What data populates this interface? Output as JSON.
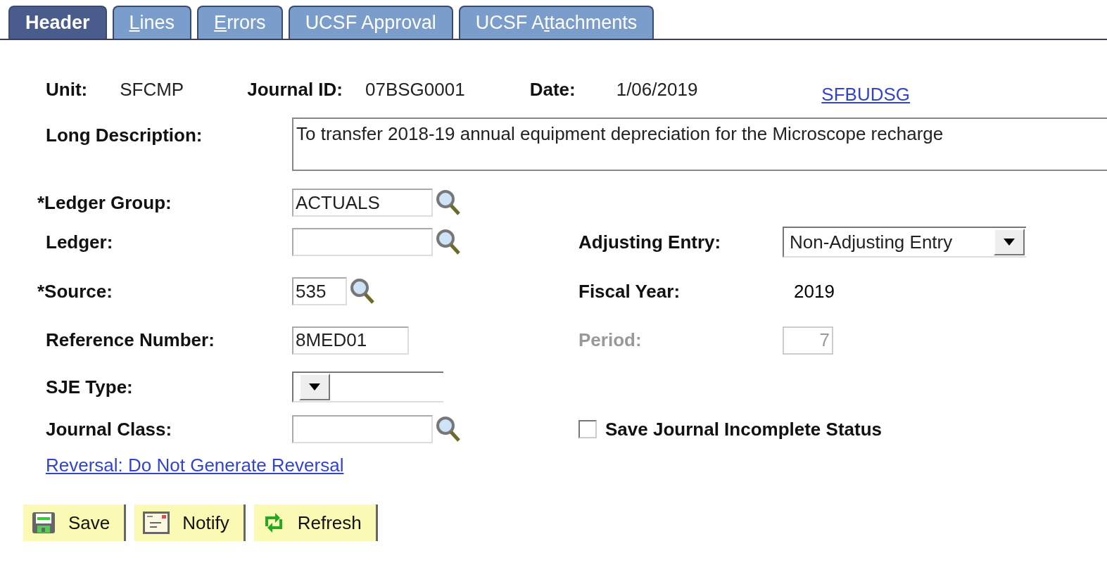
{
  "tabs": [
    {
      "label_post": "Header",
      "selected": true
    },
    {
      "access_key": "L",
      "label_post": "ines",
      "selected": false
    },
    {
      "access_key": "E",
      "label_post": "rrors",
      "selected": false
    },
    {
      "label_post": "UCSF Approval",
      "selected": false
    },
    {
      "label_pre": "UCSF A",
      "access_key": "t",
      "label_post": "tachments",
      "selected": false
    }
  ],
  "summary": [
    {
      "label": "Unit:",
      "value": "SFCMP"
    },
    {
      "label": "Journal ID:",
      "value": "07BSG0001"
    },
    {
      "label": "Date:",
      "value": "1/06/2019"
    }
  ],
  "user_link": "SFBUDSG",
  "long_description": {
    "label": "Long Description:",
    "value": "To transfer 2018-19 annual equipment depreciation for the Microscope recharge"
  },
  "rows": [
    {
      "left": {
        "label": "*Ledger Group:",
        "kind": "lookup",
        "value": "ACTUALS"
      }
    },
    {
      "left": {
        "label": "Ledger:",
        "kind": "lookup"
      },
      "right": {
        "label": "Adjusting Entry:",
        "kind": "select",
        "value": "Non-Adjusting Entry"
      }
    },
    {
      "left": {
        "label": "*Source:",
        "kind": "lookup",
        "value": "535"
      },
      "right": {
        "label": "Fiscal Year:",
        "kind": "display",
        "value": "2019"
      }
    },
    {
      "left": {
        "label": "Reference Number:",
        "kind": "text",
        "value": "8MED01"
      },
      "right": {
        "label": "Period:",
        "kind": "text",
        "value": "7",
        "disabled": true
      }
    },
    {
      "left": {
        "label": "SJE Type:",
        "kind": "select"
      }
    },
    {
      "left": {
        "label": "Journal Class:",
        "kind": "lookup"
      },
      "right": {
        "label": "Save Journal Incomplete Status",
        "kind": "checkbox",
        "checked": false
      }
    }
  ],
  "reversal_link": "Reversal: Do Not Generate Reversal",
  "buttons": [
    {
      "label": "Save",
      "kind": "save"
    },
    {
      "label": "Notify",
      "kind": "notify"
    },
    {
      "label": "Refresh",
      "kind": "refresh"
    }
  ]
}
